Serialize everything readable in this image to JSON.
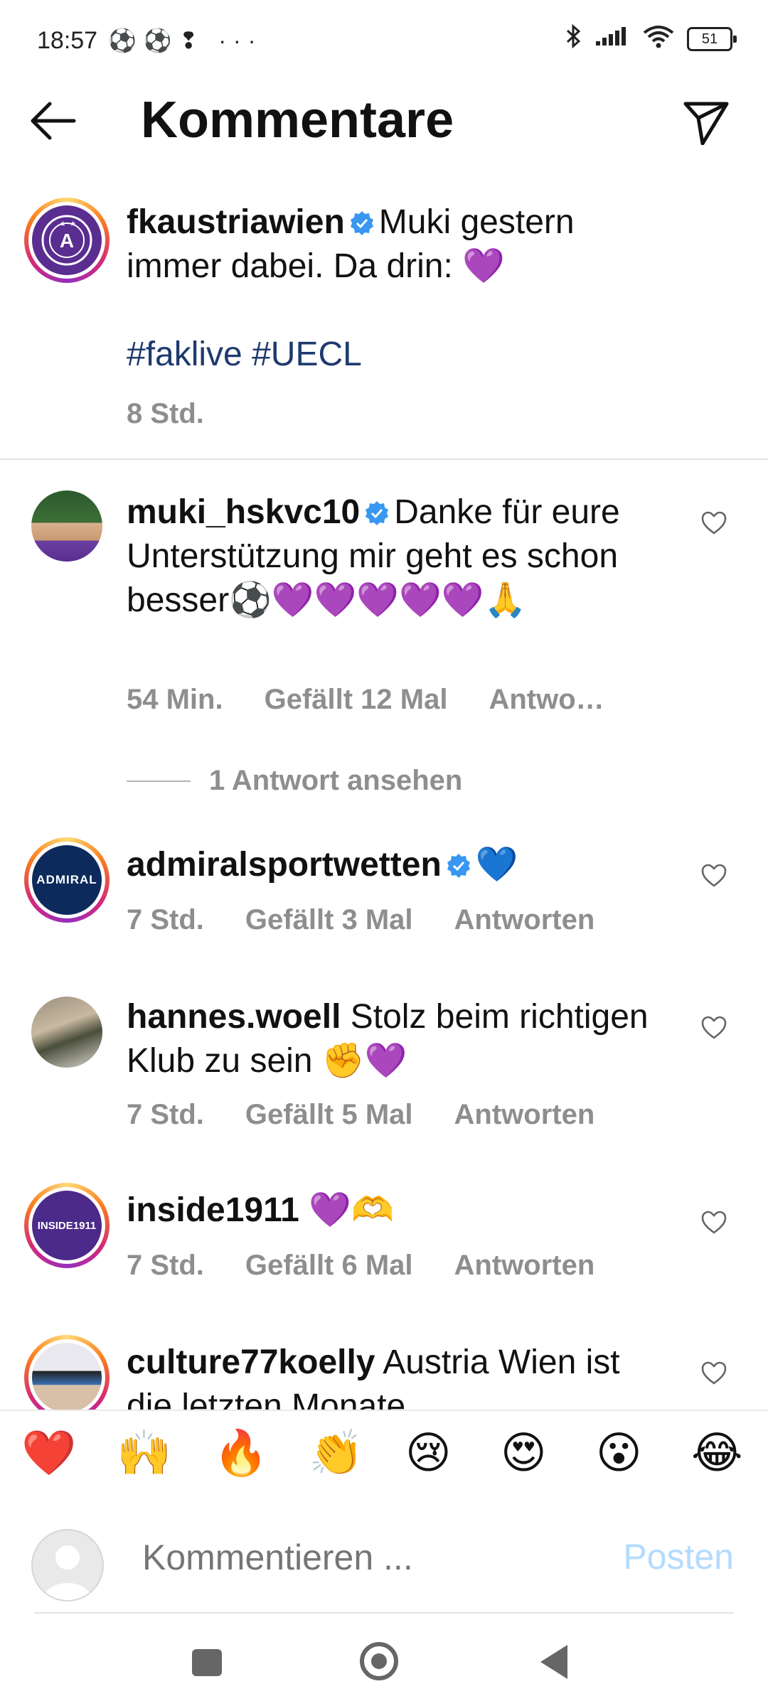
{
  "status": {
    "time": "18:57",
    "left_icons": "⚽⚽❢ ···",
    "battery": "51"
  },
  "header": {
    "title": "Kommentare"
  },
  "caption": {
    "username": "fkaustriawien",
    "text": "Muki gestern immer dabei. Da drin: 💜",
    "hashtags": "#faklive #UECL",
    "time": "8 Std."
  },
  "comments": [
    {
      "username": "muki_hskvc10",
      "verified": true,
      "text": "Danke für eure Unterstützung mir geht es schon besser⚽💜💜💜💜💜🙏",
      "time": "54 Min.",
      "likes": "Gefällt 12 Mal",
      "reply": "Antwo…",
      "view_replies": "1 Antwort ansehen"
    },
    {
      "username": "admiralsportwetten",
      "verified": true,
      "text": "💙",
      "time": "7 Std.",
      "likes": "Gefällt 3 Mal",
      "reply": "Antworten",
      "avatar_label": "ADMIRAL"
    },
    {
      "username": "hannes.woell",
      "verified": false,
      "text": "Stolz beim richtigen Klub zu sein ✊💜",
      "time": "7 Std.",
      "likes": "Gefällt 5 Mal",
      "reply": "Antworten"
    },
    {
      "username": "inside1911",
      "verified": false,
      "text": "💜🫶",
      "time": "7 Std.",
      "likes": "Gefällt 6 Mal",
      "reply": "Antworten",
      "avatar_label": "INSIDE1911"
    },
    {
      "username": "culture77koelly",
      "verified": false,
      "text": "Austria Wien ist die letzten Monate"
    }
  ],
  "emoji_bar": [
    "❤️",
    "🙌",
    "🔥",
    "👏",
    "😢",
    "😍",
    "😮",
    "😂"
  ],
  "input": {
    "placeholder": "Kommentieren ...",
    "post_label": "Posten"
  },
  "colors": {
    "verified": "#3897f0",
    "hashtag": "#1e3a6e",
    "muted": "#8e8e8e",
    "post_disabled": "#b3dbff"
  }
}
